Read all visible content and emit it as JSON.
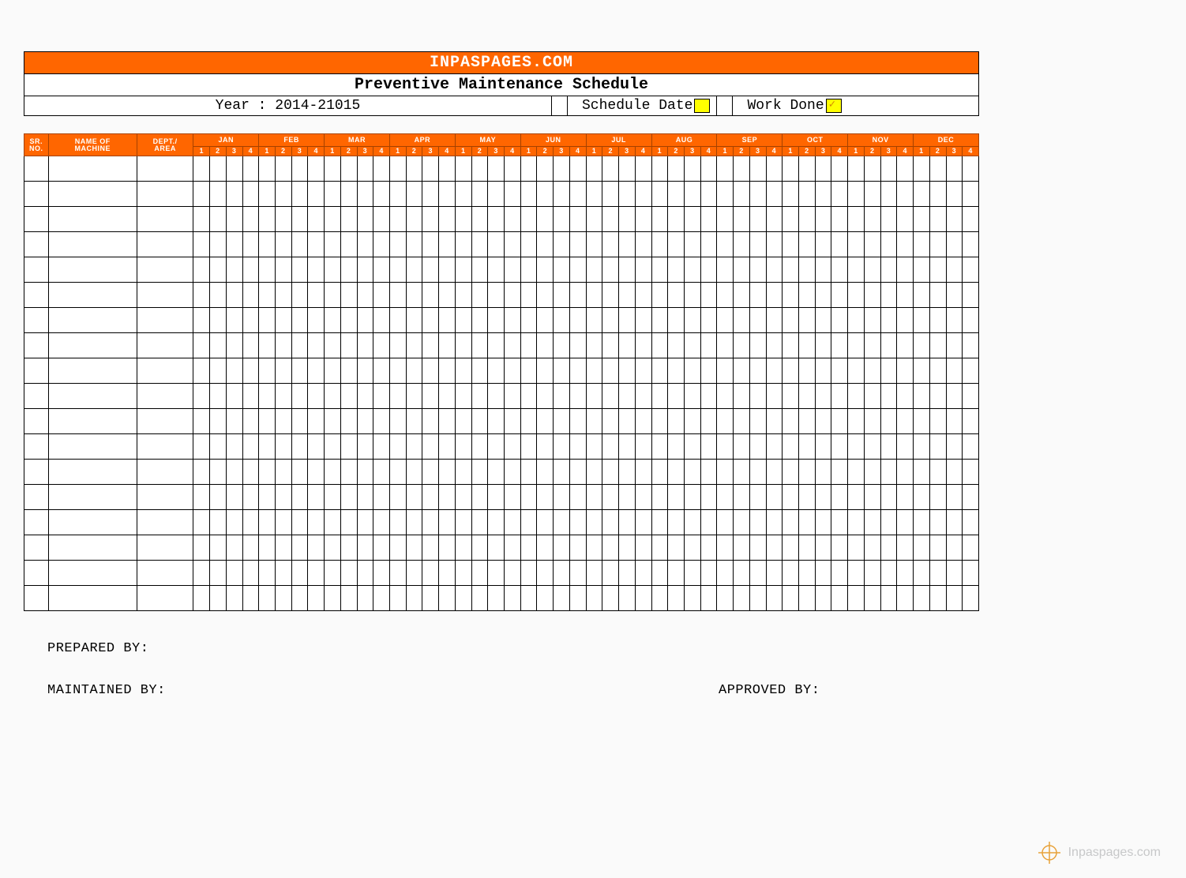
{
  "header": {
    "site": "INPASPAGES.COM",
    "title": "Preventive Maintenance Schedule",
    "year_label": "Year : 2014-21015",
    "legend": {
      "schedule": "Schedule Date",
      "done": "Work Done",
      "done_check": "✓"
    }
  },
  "columns": {
    "sr": "SR. NO.",
    "sr_line1": "SR.",
    "sr_line2": "NO.",
    "name_line1": "NAME OF",
    "name_line2": "MACHINE",
    "dept_line1": "DEPT./",
    "dept_line2": "AREA"
  },
  "months": [
    "JAN",
    "FEB",
    "MAR",
    "APR",
    "MAY",
    "JUN",
    "JUL",
    "AUG",
    "SEP",
    "OCT",
    "NOV",
    "DEC"
  ],
  "weeks": [
    "1",
    "2",
    "3",
    "4"
  ],
  "row_count": 18,
  "footer": {
    "prepared": "PREPARED BY:",
    "maintained": "MAINTAINED BY:",
    "approved": "APPROVED BY:"
  },
  "watermark": "Inpaspages.com",
  "colors": {
    "accent": "#ff6600",
    "highlight": "#ffff00"
  }
}
